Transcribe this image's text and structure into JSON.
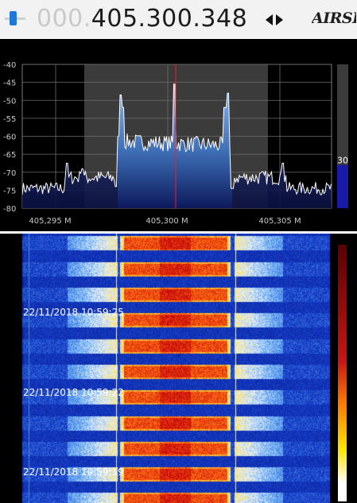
{
  "header": {
    "freq_dim": "000.",
    "freq_lit": "405.300.348",
    "logo_text": "AIRSPY"
  },
  "spectrum": {
    "db_axis": [
      "-40",
      "-45",
      "-50",
      "-55",
      "-60",
      "-65",
      "-70",
      "-75",
      "-80"
    ],
    "freq_ticks": [
      "405,295 M",
      "405,300 M",
      "405,305 M"
    ],
    "level_value": "30",
    "level_fraction": 0.3
  },
  "waterfall": {
    "timestamps": [
      "22/11/2018 10:59:25",
      "22/11/2018 10:59:22",
      "22/11/2018 10:59:19"
    ]
  },
  "colors": {
    "accent": "#1f78d6",
    "center_line": "#ff1a1a",
    "filter_band": "#3b3b3b",
    "signal_fill": "#6aa0d8"
  }
}
